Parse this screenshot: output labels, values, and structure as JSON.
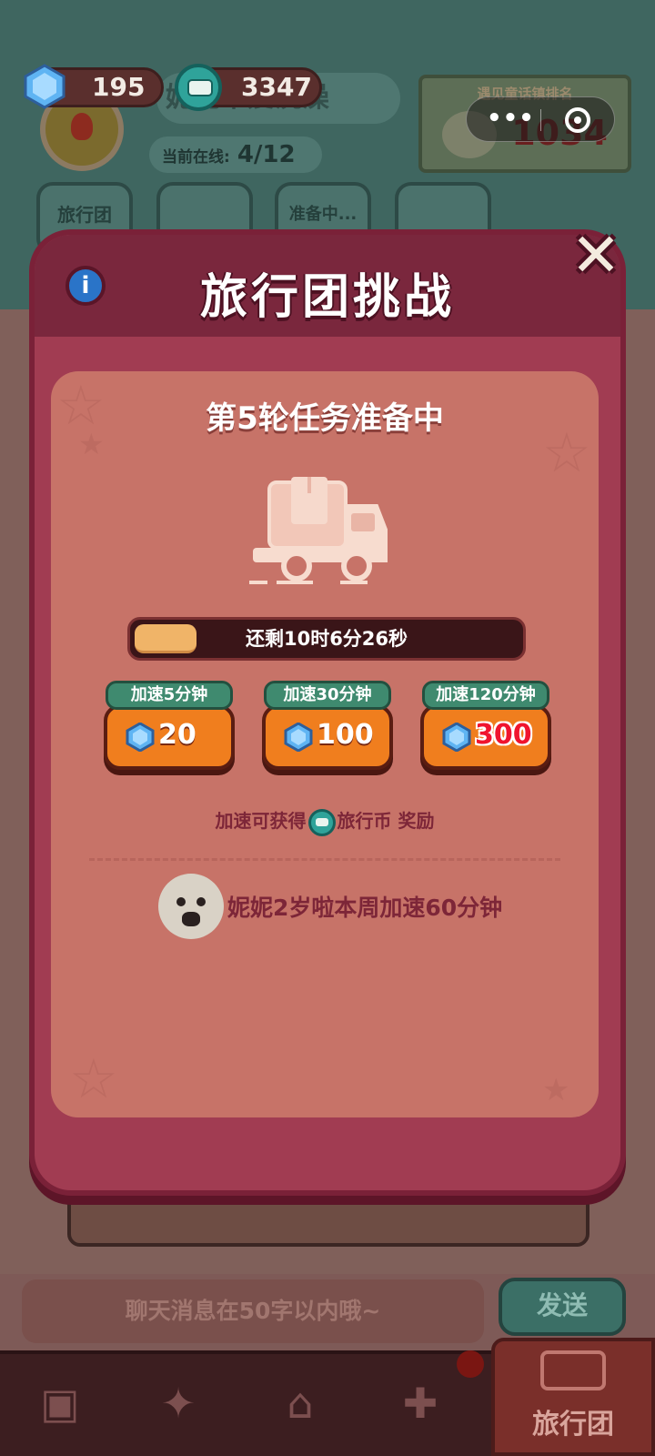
{
  "top_bar": {
    "gems": "195",
    "travel_coins": "3347",
    "room_name": "妮妮不爱洗澡",
    "online_label": "当前在线:",
    "online_count": "4/12",
    "rank_label": "遇见童话镇排名",
    "rank_value": "1034"
  },
  "tabs": [
    "旅行团",
    "",
    "准备中...",
    ""
  ],
  "modal": {
    "title": "旅行团挑战",
    "info_symbol": "i",
    "close_symbol": "✕",
    "round_status": "第5轮任务准备中",
    "progress": {
      "remaining_text": "还剩10时6分26秒",
      "fill_fraction": 0.16
    },
    "speedups": [
      {
        "label": "加速5分钟",
        "cost": "20",
        "highlight": false
      },
      {
        "label": "加速30分钟",
        "cost": "100",
        "highlight": false
      },
      {
        "label": "加速120分钟",
        "cost": "300",
        "highlight": true
      }
    ],
    "reward_prefix": "加速可获得",
    "reward_coin_name": "旅行币",
    "reward_suffix": "奖励",
    "player_activity": "妮妮2岁啦本周加速60分钟"
  },
  "chat": {
    "placeholder": "聊天消息在50字以内哦~",
    "send_label": "发送"
  },
  "bottom_nav": {
    "active_label": "旅行团"
  },
  "colors": {
    "modal_body": "#a13c52",
    "panel": "#c77368",
    "speed_button": "#f07e1e",
    "speed_tag": "#3f8a6f",
    "progress_fill": "#f0b468"
  }
}
